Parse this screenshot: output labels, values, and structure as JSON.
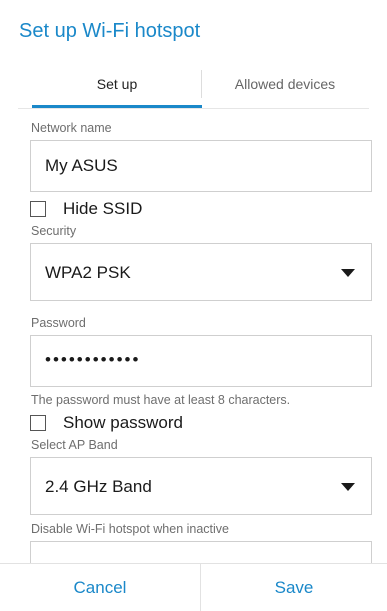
{
  "dialog": {
    "title": "Set up Wi-Fi hotspot"
  },
  "tabs": [
    {
      "label": "Set up",
      "selected": true
    },
    {
      "label": "Allowed devices",
      "selected": false
    }
  ],
  "form": {
    "network_name": {
      "label": "Network name",
      "value": "My ASUS"
    },
    "hide_ssid": {
      "label": "Hide SSID",
      "checked": false
    },
    "security": {
      "label": "Security",
      "value": "WPA2 PSK"
    },
    "password": {
      "label": "Password",
      "value_masked": "••••••••••••",
      "hint": "The password must have at least 8 characters."
    },
    "show_password": {
      "label": "Show password",
      "checked": false
    },
    "ap_band": {
      "label": "Select AP Band",
      "value": "2.4 GHz Band"
    },
    "disable_inactive": {
      "label": "Disable Wi-Fi hotspot when inactive",
      "value": ""
    }
  },
  "buttons": {
    "cancel": "Cancel",
    "save": "Save"
  },
  "colors": {
    "accent": "#1a88c9",
    "text": "#212121",
    "label": "#6e6e6e",
    "border": "#cfcfcf"
  },
  "icons": {
    "dropdown": "caret-down-icon",
    "checkbox": "checkbox-unchecked-icon"
  }
}
